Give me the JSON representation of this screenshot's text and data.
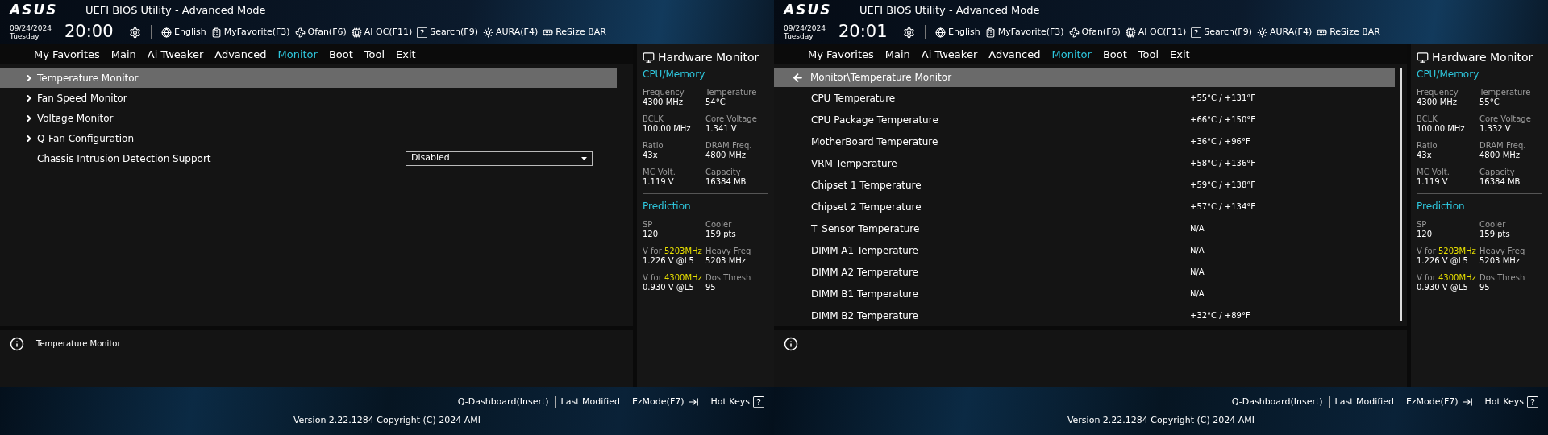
{
  "screens": [
    {
      "header": {
        "logo": "ASUS",
        "title": "UEFI BIOS Utility - Advanced Mode",
        "date": "09/24/2024",
        "day": "Tuesday",
        "time": "20:00",
        "toolbar": [
          {
            "kind": "settings"
          },
          {
            "kind": "language",
            "label": "English"
          },
          {
            "kind": "favorite",
            "label": "MyFavorite(F3)"
          },
          {
            "kind": "fan",
            "label": "Qfan(F6)"
          },
          {
            "kind": "aioc",
            "label": "AI OC(F11)"
          },
          {
            "kind": "search",
            "label": "Search(F9)"
          },
          {
            "kind": "aura",
            "label": "AURA(F4)"
          },
          {
            "kind": "resizebar",
            "label": "ReSize BAR"
          }
        ]
      },
      "nav": [
        {
          "label": "My Favorites",
          "selected": false
        },
        {
          "label": "Main",
          "selected": false
        },
        {
          "label": "Ai Tweaker",
          "selected": false
        },
        {
          "label": "Advanced",
          "selected": false
        },
        {
          "label": "Monitor",
          "selected": true
        },
        {
          "label": "Boot",
          "selected": false
        },
        {
          "label": "Tool",
          "selected": false
        },
        {
          "label": "Exit",
          "selected": false
        }
      ],
      "content": {
        "kind": "menu",
        "items": [
          {
            "kind": "submenu",
            "label": "Temperature Monitor",
            "selected": true
          },
          {
            "kind": "submenu",
            "label": "Fan Speed Monitor",
            "selected": false
          },
          {
            "kind": "submenu",
            "label": "Voltage Monitor",
            "selected": false
          },
          {
            "kind": "submenu",
            "label": "Q-Fan Configuration",
            "selected": false
          },
          {
            "kind": "setting",
            "label": "Chassis Intrusion Detection Support",
            "value": "Disabled",
            "selected": false
          }
        ]
      },
      "help_text": "Temperature Monitor",
      "hardware_monitor": {
        "title": "Hardware Monitor",
        "sections": [
          {
            "title": "CPU/Memory",
            "items": [
              {
                "label": "Frequency",
                "value": "4300 MHz"
              },
              {
                "label": "Temperature",
                "value": "54°C"
              },
              {
                "label": "BCLK",
                "value": "100.00 MHz"
              },
              {
                "label": "Core Voltage",
                "value": "1.341 V"
              },
              {
                "label": "Ratio",
                "value": "43x"
              },
              {
                "label": "DRAM Freq.",
                "value": "4800 MHz"
              },
              {
                "label": "MC Volt.",
                "value": "1.119 V"
              },
              {
                "label": "Capacity",
                "value": "16384 MB"
              }
            ]
          },
          {
            "title": "Prediction",
            "items": [
              {
                "label": "SP",
                "value": "120"
              },
              {
                "label": "Cooler",
                "value": "159 pts"
              },
              {
                "label": "V for",
                "accent": "5203MHz",
                "value": "1.226 V @L5"
              },
              {
                "label": "Heavy Freq",
                "value": "5203 MHz"
              },
              {
                "label": "V for",
                "accent": "4300MHz",
                "value": "0.930 V @L5"
              },
              {
                "label": "Dos Thresh",
                "value": "95"
              }
            ]
          }
        ]
      },
      "footer": {
        "hotkeys": [
          {
            "kind": "plain",
            "label": "Q-Dashboard(Insert)"
          },
          {
            "kind": "plain",
            "label": "Last Modified"
          },
          {
            "kind": "exit",
            "label": "EzMode(F7)"
          },
          {
            "kind": "help",
            "label": "Hot Keys"
          }
        ],
        "version": "Version 2.22.1284 Copyright (C) 2024 AMI"
      }
    },
    {
      "header": {
        "logo": "ASUS",
        "title": "UEFI BIOS Utility - Advanced Mode",
        "date": "09/24/2024",
        "day": "Tuesday",
        "time": "20:01",
        "toolbar": [
          {
            "kind": "settings"
          },
          {
            "kind": "language",
            "label": "English"
          },
          {
            "kind": "favorite",
            "label": "MyFavorite(F3)"
          },
          {
            "kind": "fan",
            "label": "Qfan(F6)"
          },
          {
            "kind": "aioc",
            "label": "AI OC(F11)"
          },
          {
            "kind": "search",
            "label": "Search(F9)"
          },
          {
            "kind": "aura",
            "label": "AURA(F4)"
          },
          {
            "kind": "resizebar",
            "label": "ReSize BAR"
          }
        ]
      },
      "nav": [
        {
          "label": "My Favorites",
          "selected": false
        },
        {
          "label": "Main",
          "selected": false
        },
        {
          "label": "Ai Tweaker",
          "selected": false
        },
        {
          "label": "Advanced",
          "selected": false
        },
        {
          "label": "Monitor",
          "selected": true
        },
        {
          "label": "Boot",
          "selected": false
        },
        {
          "label": "Tool",
          "selected": false
        },
        {
          "label": "Exit",
          "selected": false
        }
      ],
      "content": {
        "kind": "list",
        "breadcrumb": "Monitor\\Temperature Monitor",
        "rows": [
          {
            "label": "CPU Temperature",
            "value": "+55°C / +131°F"
          },
          {
            "label": "CPU Package Temperature",
            "value": "+66°C / +150°F"
          },
          {
            "label": "MotherBoard Temperature",
            "value": "+36°C / +96°F"
          },
          {
            "label": "VRM Temperature",
            "value": "+58°C / +136°F"
          },
          {
            "label": "Chipset 1 Temperature",
            "value": "+59°C / +138°F"
          },
          {
            "label": "Chipset 2 Temperature",
            "value": "+57°C / +134°F"
          },
          {
            "label": "T_Sensor Temperature",
            "value": "N/A"
          },
          {
            "label": "DIMM A1 Temperature",
            "value": "N/A"
          },
          {
            "label": "DIMM A2 Temperature",
            "value": "N/A"
          },
          {
            "label": "DIMM B1 Temperature",
            "value": "N/A"
          },
          {
            "label": "DIMM B2 Temperature",
            "value": "+32°C / +89°F"
          }
        ]
      },
      "hardware_monitor": {
        "title": "Hardware Monitor",
        "sections": [
          {
            "title": "CPU/Memory",
            "items": [
              {
                "label": "Frequency",
                "value": "4300 MHz"
              },
              {
                "label": "Temperature",
                "value": "55°C"
              },
              {
                "label": "BCLK",
                "value": "100.00 MHz"
              },
              {
                "label": "Core Voltage",
                "value": "1.332 V"
              },
              {
                "label": "Ratio",
                "value": "43x"
              },
              {
                "label": "DRAM Freq.",
                "value": "4800 MHz"
              },
              {
                "label": "MC Volt.",
                "value": "1.119 V"
              },
              {
                "label": "Capacity",
                "value": "16384 MB"
              }
            ]
          },
          {
            "title": "Prediction",
            "items": [
              {
                "label": "SP",
                "value": "120"
              },
              {
                "label": "Cooler",
                "value": "159 pts"
              },
              {
                "label": "V for",
                "accent": "5203MHz",
                "value": "1.226 V @L5"
              },
              {
                "label": "Heavy Freq",
                "value": "5203 MHz"
              },
              {
                "label": "V for",
                "accent": "4300MHz",
                "value": "0.930 V @L5"
              },
              {
                "label": "Dos Thresh",
                "value": "95"
              }
            ]
          }
        ]
      },
      "footer": {
        "hotkeys": [
          {
            "kind": "plain",
            "label": "Q-Dashboard(Insert)"
          },
          {
            "kind": "plain",
            "label": "Last Modified"
          },
          {
            "kind": "exit",
            "label": "EzMode(F7)"
          },
          {
            "kind": "help",
            "label": "Hot Keys"
          }
        ],
        "version": "Version 2.22.1284 Copyright (C) 2024 AMI"
      }
    }
  ]
}
